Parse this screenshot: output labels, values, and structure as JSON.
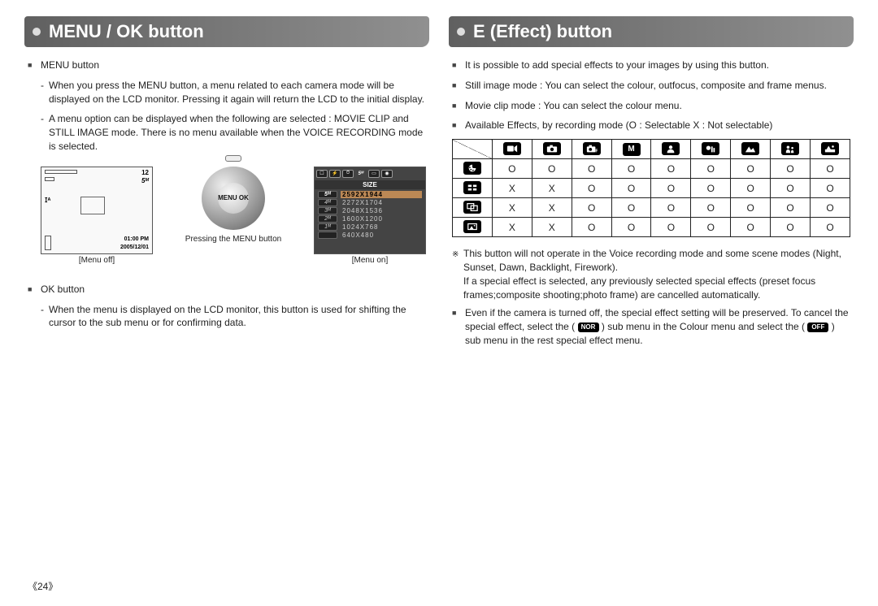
{
  "page_number": "《24》",
  "left": {
    "header": "MENU / OK button",
    "menu_btn_title": "MENU button",
    "menu_btn_p1": "When you press the MENU button, a menu related to each camera mode will be displayed on the LCD monitor. Pressing it again will return the LCD to the initial display.",
    "menu_btn_p2": "A menu option can be displayed when the following are selected : MOVIE CLIP and STILL IMAGE mode. There is no menu available when the VOICE RECORDING mode is selected.",
    "lcd_off": {
      "num": "12",
      "fivem": "5ᴹ",
      "flash": "𐌆ᴬ",
      "time": "01:00 PM",
      "date": "2005/12/01",
      "caption": "[Menu off]"
    },
    "dial": {
      "center": "MENU OK",
      "caption": "Pressing the MENU button"
    },
    "lcd_on": {
      "title": "SIZE",
      "rows": [
        {
          "k": "5ᴹ",
          "v": "2592X1944"
        },
        {
          "k": "4ᴹ",
          "v": "2272X1704"
        },
        {
          "k": "3ᴹ",
          "v": "2048X1536"
        },
        {
          "k": "2ᴹ",
          "v": "1600X1200"
        },
        {
          "k": "1ᴹ",
          "v": "1024X768"
        },
        {
          "k": "",
          "v": "640X480"
        }
      ],
      "caption": "[Menu on]"
    },
    "ok_btn_title": "OK button",
    "ok_btn_p1": "When the menu is displayed on the LCD monitor, this button is used for shifting the cursor to the sub menu or for confirming data."
  },
  "right": {
    "header": "E (Effect) button",
    "p1": "It is possible to add special effects to your images by using this button.",
    "p2": "Still image mode : You can select the colour, outfocus, composite and frame menus.",
    "p3": "Movie clip mode : You can select the colour menu.",
    "p4": "Available Effects, by recording mode (O : Selectable X : Not selectable)",
    "table": {
      "cols": [
        "video",
        "camera",
        "camera-p",
        "M",
        "face",
        "nightscene",
        "mountain",
        "kids",
        "beach"
      ],
      "rowicons": [
        "palette",
        "grid",
        "composite",
        "frame"
      ],
      "rows": [
        [
          "O",
          "O",
          "O",
          "O",
          "O",
          "O",
          "O",
          "O",
          "O"
        ],
        [
          "X",
          "X",
          "O",
          "O",
          "O",
          "O",
          "O",
          "O",
          "O"
        ],
        [
          "X",
          "X",
          "O",
          "O",
          "O",
          "O",
          "O",
          "O",
          "O"
        ],
        [
          "X",
          "X",
          "O",
          "O",
          "O",
          "O",
          "O",
          "O",
          "O"
        ]
      ]
    },
    "note1": "This button will not operate in the Voice recording mode and some scene modes (Night, Sunset, Dawn, Backlight, Firework).",
    "note1b": "If a special effect is selected, any previously selected special effects (preset focus frames;composite shooting;photo frame) are cancelled automatically.",
    "note2a": "Even if the camera is turned off, the special effect setting will be preserved. To cancel the special effect, select the (",
    "note2_ic1": "NOR",
    "note2b": ") sub menu in the Colour menu and select the (",
    "note2_ic2": "OFF",
    "note2c": ") sub menu in the rest special effect menu."
  }
}
